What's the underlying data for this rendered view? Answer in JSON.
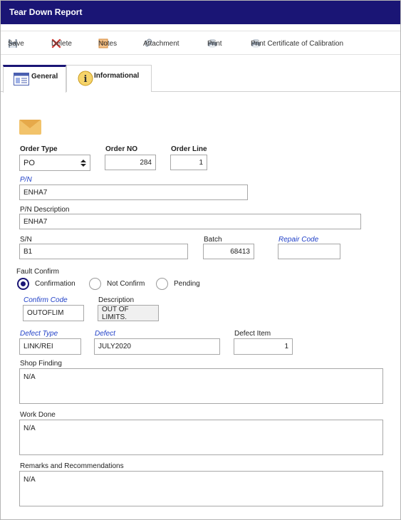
{
  "window": {
    "title": "Tear Down Report"
  },
  "toolbar": {
    "save": "Save",
    "delete": "Delete",
    "notes": "Notes",
    "attachment": "Attachment",
    "print": "Print",
    "print_cert": "Print Certificate of Calibration"
  },
  "tabs": [
    {
      "label": "General",
      "icon": "form-icon",
      "active": true
    },
    {
      "label": "Informational",
      "icon": "info-icon",
      "active": false
    }
  ],
  "form": {
    "order_type": {
      "label": "Order Type",
      "value": "PO"
    },
    "order_no": {
      "label": "Order NO",
      "value": "284"
    },
    "order_line": {
      "label": "Order Line",
      "value": "1"
    },
    "pn": {
      "label": "P/N",
      "value": "ENHA7"
    },
    "pn_desc": {
      "label": "P/N Description",
      "value": "ENHA7"
    },
    "sn": {
      "label": "S/N",
      "value": "B1"
    },
    "batch": {
      "label": "Batch",
      "value": "68413"
    },
    "repair_code": {
      "label": "Repair Code",
      "value": ""
    },
    "fault_confirm": {
      "label": "Fault Confirm",
      "options": [
        "Confirmation",
        "Not Confirm",
        "Pending"
      ],
      "selected": "Confirmation"
    },
    "confirm_code": {
      "label": "Confirm Code",
      "value": "OUTOFLIM"
    },
    "description": {
      "label": "Description",
      "value": "OUT OF LIMITS."
    },
    "defect_type": {
      "label": "Defect Type",
      "value": "LINK/REI"
    },
    "defect": {
      "label": "Defect",
      "value": "JULY2020"
    },
    "defect_item": {
      "label": "Defect Item",
      "value": "1"
    },
    "shop_finding": {
      "label": "Shop Finding",
      "value": "N/A"
    },
    "work_done": {
      "label": "Work Done",
      "value": "N/A"
    },
    "remarks": {
      "label": "Remarks and Recommendations",
      "value": "N/A"
    }
  },
  "colors": {
    "titlebar": "#1a1575",
    "link_label": "#1f3fc7",
    "envelope": "#f2c36b"
  }
}
